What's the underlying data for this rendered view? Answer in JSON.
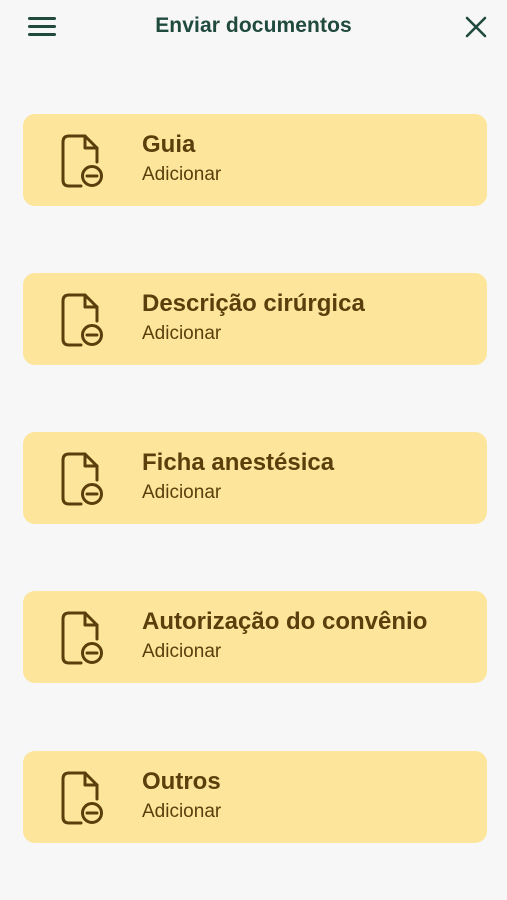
{
  "header": {
    "title": "Enviar documentos",
    "menu_icon": "hamburger-menu-icon",
    "close_icon": "close-icon"
  },
  "colors": {
    "header_text": "#1f4a3d",
    "card_bg": "#fde69b",
    "card_text": "#5a3f0c",
    "background": "#f7f7f7"
  },
  "documents": [
    {
      "title": "Guia",
      "action": "Adicionar"
    },
    {
      "title": "Descrição cirúrgica",
      "action": "Adicionar"
    },
    {
      "title": "Ficha anestésica",
      "action": "Adicionar"
    },
    {
      "title": "Autorização do convênio",
      "action": "Adicionar"
    },
    {
      "title": "Outros",
      "action": "Adicionar"
    }
  ]
}
